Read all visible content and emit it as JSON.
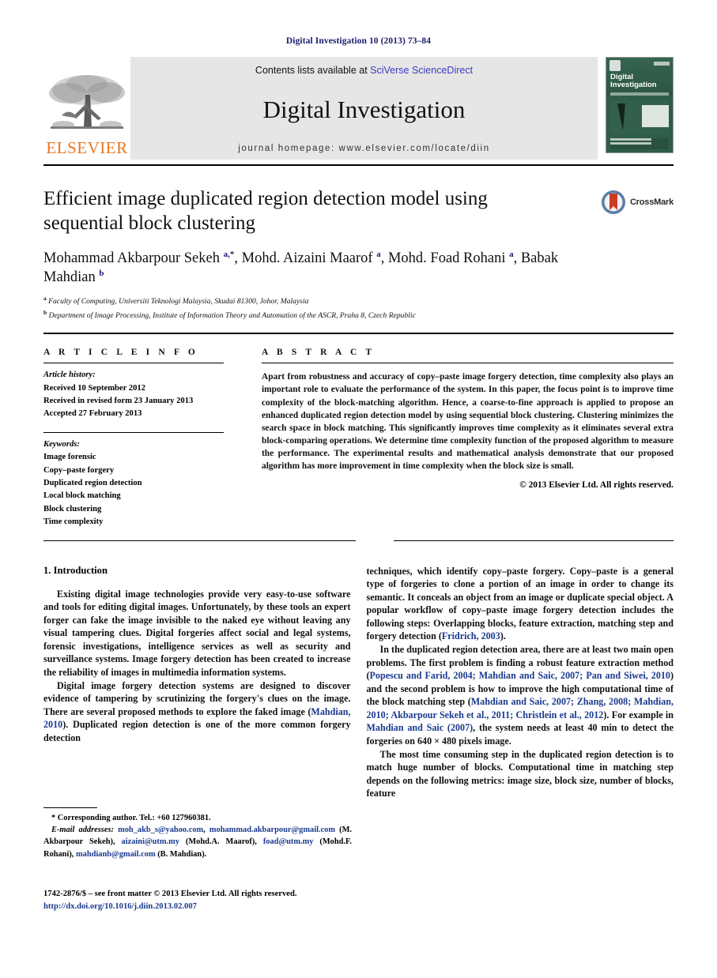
{
  "running_head": "Digital Investigation 10 (2013) 73–84",
  "banner": {
    "publisher_name": "ELSEVIER",
    "contents_prefix": "Contents lists available at ",
    "sciencedirect_link": "SciVerse ScienceDirect",
    "journal_name": "Digital Investigation",
    "homepage": "journal homepage: www.elsevier.com/locate/diin",
    "cover": {
      "title_line1": "Digital",
      "title_line2": "Investigation"
    }
  },
  "article": {
    "title": "Efficient image duplicated region detection model using sequential block clustering",
    "authors_html": "Mohammad Akbarpour Sekeh <sup>a,*</sup>, Mohd. Aizaini Maarof <sup>a</sup>, Mohd. Foad Rohani <sup>a</sup>, Babak Mahdian <sup>b</sup>",
    "affiliations": [
      {
        "marker": "a",
        "text": "Faculty of Computing, Universiti Teknologi Malaysia, Skudai 81300, Johor, Malaysia"
      },
      {
        "marker": "b",
        "text": "Department of Image Processing, Institute of Information Theory and Automation of the ASCR, Praha 8, Czech Republic"
      }
    ],
    "crossmark_label": "CrossMark"
  },
  "article_info": {
    "heading": "A R T I C L E   I N F O",
    "history_label": "Article history:",
    "history": [
      "Received 10 September 2012",
      "Received in revised form 23 January 2013",
      "Accepted 27 February 2013"
    ],
    "keywords_label": "Keywords:",
    "keywords": [
      "Image forensic",
      "Copy–paste forgery",
      "Duplicated region detection",
      "Local block matching",
      "Block clustering",
      "Time complexity"
    ]
  },
  "abstract": {
    "heading": "A B S T R A C T",
    "text": "Apart from robustness and accuracy of copy–paste image forgery detection, time complexity also plays an important role to evaluate the performance of the system. In this paper, the focus point is to improve time complexity of the block-matching algorithm. Hence, a coarse-to-fine approach is applied to propose an enhanced duplicated region detection model by using sequential block clustering. Clustering minimizes the search space in block matching. This significantly improves time complexity as it eliminates several extra block-comparing operations. We determine time complexity function of the proposed algorithm to measure the performance. The experimental results and mathematical analysis demonstrate that our proposed algorithm has more improvement in time complexity when the block size is small.",
    "copyright": "© 2013 Elsevier Ltd. All rights reserved."
  },
  "body": {
    "section_heading": "1. Introduction",
    "left_paragraphs": [
      "Existing digital image technologies provide very easy-to-use software and tools for editing digital images. Unfortunately, by these tools an expert forger can fake the image invisible to the naked eye without leaving any visual tampering clues. Digital forgeries affect social and legal systems, forensic investigations, intelligence services as well as security and surveillance systems. Image forgery detection has been created to increase the reliability of images in multimedia information systems."
    ],
    "left_paragraph2_pre": "Digital image forgery detection systems are designed to discover evidence of tampering by scrutinizing the forgery's clues on the image. There are several proposed methods to explore the faked image (",
    "left_paragraph2_cite": "Mahdian, 2010",
    "left_paragraph2_post": "). Duplicated region detection is one of the more common forgery detection",
    "right_paragraph1_pre": "techniques, which identify copy–paste forgery. Copy–paste is a general type of forgeries to clone a portion of an image in order to change its semantic. It conceals an object from an image or duplicate special object. A popular workflow of copy–paste image forgery detection includes the following steps: Overlapping blocks, feature extraction, matching step and forgery detection (",
    "right_paragraph1_cite": "Fridrich, 2003",
    "right_paragraph1_post": ").",
    "right_paragraph2_parts": [
      {
        "t": "In the duplicated region detection area, there are at least two main open problems. The first problem is finding a robust feature extraction method (",
        "cite": false
      },
      {
        "t": "Popescu and Farid, 2004; Mahdian and Saic, 2007; Pan and Siwei, 2010",
        "cite": true
      },
      {
        "t": ") and the second problem is how to improve the high computational time of the block matching step (",
        "cite": false
      },
      {
        "t": "Mahdian and Saic, 2007; Zhang, 2008; Mahdian, 2010; Akbarpour Sekeh et al., 2011; Christlein et al., 2012",
        "cite": true
      },
      {
        "t": "). For example in ",
        "cite": false
      },
      {
        "t": "Mahdian and Saic (2007)",
        "cite": true
      },
      {
        "t": ", the system needs at least 40 min to detect the forgeries on 640 × 480 pixels image.",
        "cite": false
      }
    ],
    "right_paragraph3": "The most time consuming step in the duplicated region detection is to match huge number of blocks. Computational time in matching step depends on the following metrics: image size, block size, number of blocks, feature"
  },
  "footnotes": {
    "corresponding": "* Corresponding author. Tel.: +60 127960381.",
    "email_label": "E-mail addresses:",
    "email_parts": [
      {
        "t": " ",
        "link": false
      },
      {
        "t": "moh_akb_s@yahoo.com",
        "link": true
      },
      {
        "t": ", ",
        "link": false
      },
      {
        "t": "mohammad.akbarpour@gmail.com",
        "link": true
      },
      {
        "t": " (M. Akbarpour Sekeh), ",
        "link": false
      },
      {
        "t": "aizaini@utm.my",
        "link": true
      },
      {
        "t": " (Mohd.A. Maarof), ",
        "link": false
      },
      {
        "t": "foad@utm.my",
        "link": true
      },
      {
        "t": " (Mohd.F. Rohani), ",
        "link": false
      },
      {
        "t": "mahdianb@gmail.com",
        "link": true
      },
      {
        "t": " (B. Mahdian).",
        "link": false
      }
    ],
    "issn_line": "1742-2876/$ – see front matter © 2013 Elsevier Ltd. All rights reserved.",
    "doi": "http://dx.doi.org/10.1016/j.diin.2013.02.007"
  },
  "colors": {
    "link_blue": "#1a3a8f",
    "sciencedirect_blue": "#3b3bbf",
    "elsevier_orange": "#E87722",
    "cover_green": "#2f5d4a",
    "crossmark_red": "#cc3b23",
    "banner_grey": "#e6e6e6"
  }
}
